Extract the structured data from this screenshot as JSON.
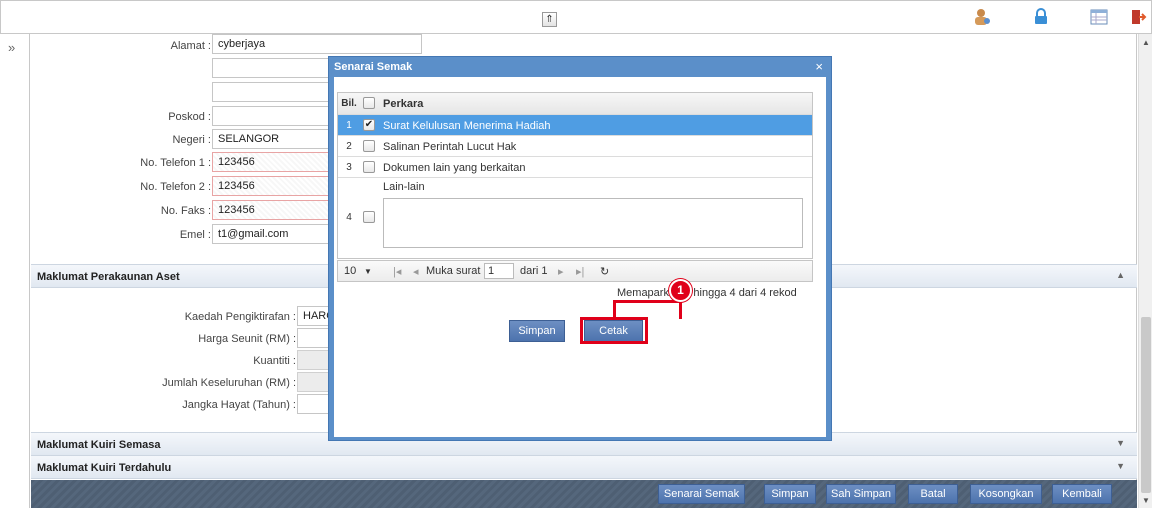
{
  "topbar": {
    "collapse_glyph": "⇑",
    "icons": [
      "user-settings-icon",
      "lock-icon",
      "table-icon",
      "logout-icon"
    ]
  },
  "sidebar": {
    "expand_glyph": "»"
  },
  "form": {
    "alamat_label": "Alamat :",
    "alamat_value": "cyberjaya",
    "poskod_label": "Poskod :",
    "poskod_value": "",
    "negeri_label": "Negeri :",
    "negeri_value": "SELANGOR",
    "tel1_label": "No. Telefon 1 :",
    "tel1_value": "123456",
    "tel2_label": "No. Telefon 2 :",
    "tel2_value": "123456",
    "faks_label": "No. Faks :",
    "faks_value": "123456",
    "emel_label": "Emel :",
    "emel_value": "t1@gmail.com"
  },
  "section_aset": {
    "title": "Maklumat Perakaunan Aset",
    "kaedah_label": "Kaedah Pengiktirafan :",
    "kaedah_value": "HARG",
    "harga_label": "Harga Seunit (RM) :",
    "kuantiti_label": "Kuantiti :",
    "jumlah_label": "Jumlah Keseluruhan (RM) :",
    "hayat_label": "Jangka Hayat (Tahun) :"
  },
  "section_kuiri_semasa": {
    "title": "Maklumat Kuiri Semasa"
  },
  "section_kuiri_terdahulu": {
    "title": "Maklumat Kuiri Terdahulu"
  },
  "footer": {
    "buttons": [
      "Senarai Semak",
      "Simpan",
      "Sah Simpan",
      "Batal",
      "Kosongkan",
      "Kembali"
    ]
  },
  "modal": {
    "title": "Senarai Semak",
    "close": "×",
    "grid": {
      "col_bil": "Bil.",
      "col_perkara": "Perkara",
      "rows": [
        {
          "no": "1",
          "checked": true,
          "label": "Surat Kelulusan Menerima Hadiah"
        },
        {
          "no": "2",
          "checked": false,
          "label": "Salinan Perintah Lucut Hak"
        },
        {
          "no": "3",
          "checked": false,
          "label": "Dokumen lain yang berkaitan"
        },
        {
          "no": "4",
          "checked": false,
          "label": "Lain-lain"
        }
      ]
    },
    "pager": {
      "page_size": "10",
      "page_label": "Muka surat",
      "page_value": "1",
      "of_label": "dari 1",
      "info": "Memaparkan 1 hingga 4 dari 4 rekod"
    },
    "simpan_label": "Simpan",
    "cetak_label": "Cetak"
  },
  "callout": {
    "number": "1",
    "color": "#e0001a"
  }
}
